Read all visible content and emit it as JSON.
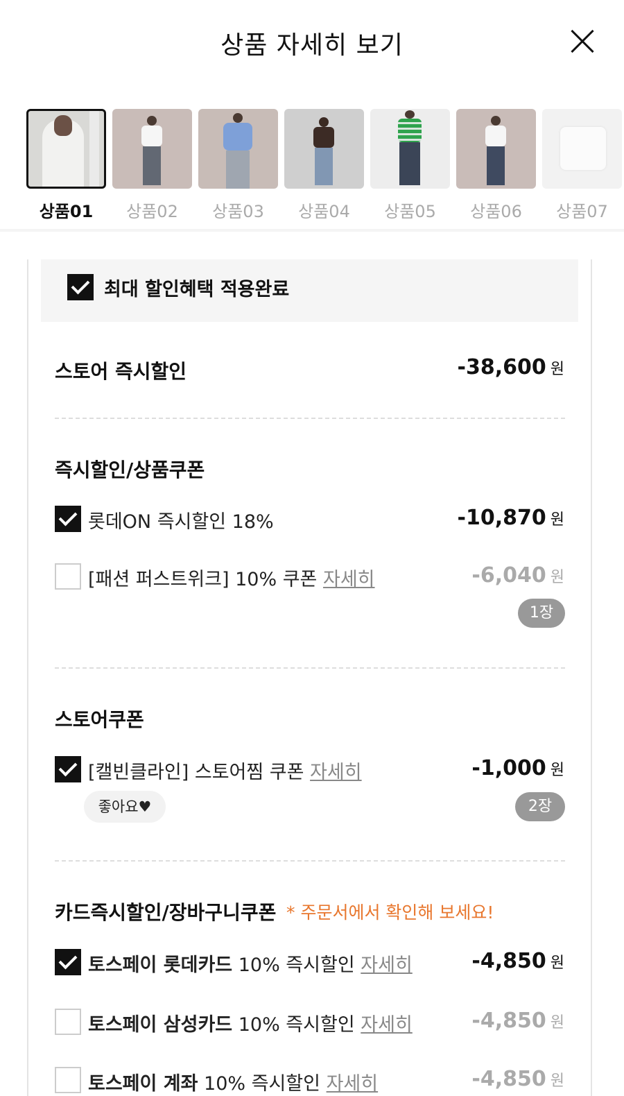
{
  "header": {
    "title": "상품 자세히 보기"
  },
  "thumbnails": [
    {
      "label": "상품01",
      "selected": true
    },
    {
      "label": "상품02",
      "selected": false
    },
    {
      "label": "상품03",
      "selected": false
    },
    {
      "label": "상품04",
      "selected": false
    },
    {
      "label": "상품05",
      "selected": false
    },
    {
      "label": "상품06",
      "selected": false
    },
    {
      "label": "상품07",
      "selected": false
    }
  ],
  "max_discount": {
    "label": "최대 할인혜택 적용완료",
    "checked": true
  },
  "store_instant": {
    "label": "스토어 즉시할인",
    "amount": "-38,600",
    "unit": "원"
  },
  "instant_coupon": {
    "title": "즉시할인/상품쿠폰",
    "items": [
      {
        "label": "롯데ON 즉시할인 18%",
        "amount": "-10,870",
        "unit": "원",
        "checked": true
      },
      {
        "label": "[패션 퍼스트위크] 10% 쿠폰",
        "link": "자세히",
        "amount": "-6,040",
        "unit": "원",
        "checked": false,
        "count": "1장"
      }
    ]
  },
  "store_coupon": {
    "title": "스토어쿠폰",
    "items": [
      {
        "label": "[캘빈클라인] 스토어찜 쿠폰",
        "link": "자세히",
        "amount": "-1,000",
        "unit": "원",
        "checked": true,
        "badge": "좋아요♥",
        "count": "2장"
      }
    ]
  },
  "card": {
    "title": "카드즉시할인/장바구니쿠폰",
    "note": "* 주문서에서 확인해 보세요!",
    "items": [
      {
        "bold": "토스페이 롯데카드",
        "label": " 10% 즉시할인",
        "link": "자세히",
        "amount": "-4,850",
        "unit": "원",
        "checked": true
      },
      {
        "bold": "토스페이 삼성카드",
        "label": " 10% 즉시할인",
        "link": "자세히",
        "amount": "-4,850",
        "unit": "원",
        "checked": false
      },
      {
        "bold": "토스페이 계좌",
        "label": " 10% 즉시할인",
        "link": "자세히",
        "amount": "-4,850",
        "unit": "원",
        "checked": false
      }
    ]
  },
  "colors": {
    "accent_orange": "#e8772e",
    "checkbox_on": "#111111",
    "pill_grey": "#999999"
  }
}
